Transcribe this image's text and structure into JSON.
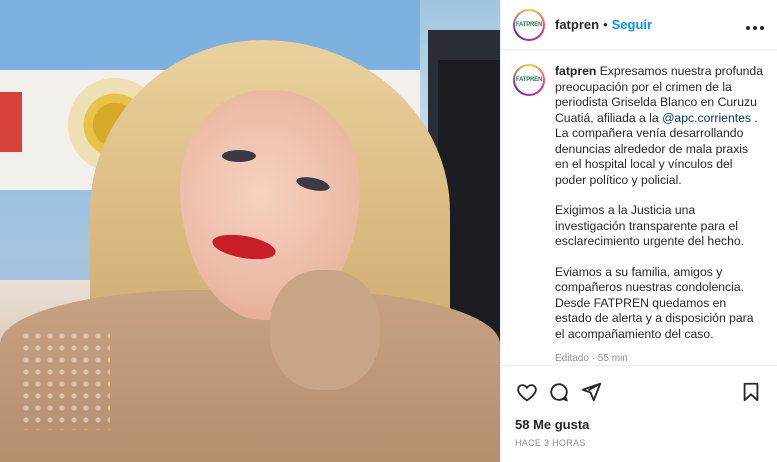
{
  "post": {
    "author": {
      "username": "fatpren",
      "avatar_text": "FATPREN",
      "follow_label": "Seguir",
      "separator": "•"
    },
    "more_icon": "more-horizontal-icon",
    "caption": {
      "username": "fatpren",
      "paragraph1_a": "Expresamos nuestra profunda preocupación por el crimen de la periodista Griselda Blanco en Curuzu Cuatiá, afiliada a la",
      "mention": "@apc.corrientes",
      "paragraph1_b": ". La compañera venía desarrollando denuncias alrededor de mala praxis en el hospital local y vínculos del poder político y policial.",
      "paragraph2": "Exigimos a la Justicia una investigación transparente para el esclarecimiento urgente del hecho.",
      "paragraph3": "Eviamos a su familia, amigos y compañeros nuestras condolencia. Desde FATPREN quedamos en estado de alerta y a disposición para el acompañamiento del caso.",
      "edited": "Editado · 55 min"
    },
    "actions": {
      "like_icon": "heart-icon",
      "comment_icon": "comment-icon",
      "share_icon": "send-icon",
      "save_icon": "bookmark-icon"
    },
    "likes": "58 Me gusta",
    "timestamp": "HACE 3 HORAS"
  },
  "colors": {
    "accent": "#0095f6",
    "mention": "#00376b",
    "text": "#262626",
    "muted": "#8e8e8e",
    "border": "#efefef"
  }
}
